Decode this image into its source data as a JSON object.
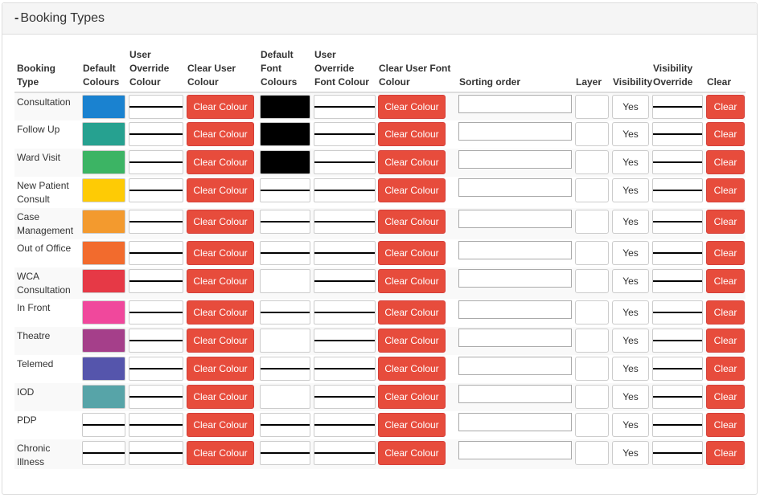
{
  "panel": {
    "toggle": "-",
    "title": "Booking Types"
  },
  "columns": {
    "booking_type": "Booking Type",
    "default_colours": "Default Colours",
    "user_override_colour": "User Override Colour",
    "clear_user_colour": "Clear User Colour",
    "default_font_colours": "Default Font Colours",
    "user_override_font_colour": "User Override Font Colour",
    "clear_user_font_colour": "Clear User Font Colour",
    "sorting_order": "Sorting order",
    "layer": "Layer",
    "visibility": "Visibility",
    "visibility_override": "Visibility Override",
    "clear": "Clear"
  },
  "labels": {
    "clear_colour": "Clear Colour",
    "clear": "Clear",
    "visibility_value": "Yes"
  },
  "rows": [
    {
      "name": "Consultation",
      "colour": "#1a82d0",
      "font_colour": "#000000"
    },
    {
      "name": "Follow Up",
      "colour": "#26a190",
      "font_colour": "#000000"
    },
    {
      "name": "Ward Visit",
      "colour": "#3cb464",
      "font_colour": "#000000"
    },
    {
      "name": "New Patient Consult",
      "colour": "#fecb05",
      "font_colour": "none"
    },
    {
      "name": "Case Management",
      "colour": "#f39a2e",
      "font_colour": "none"
    },
    {
      "name": "Out of Office",
      "colour": "#f26b2d",
      "font_colour": "none"
    },
    {
      "name": "WCA Consultation",
      "colour": "#e63946",
      "font_colour": "empty"
    },
    {
      "name": "In Front",
      "colour": "#f0489c",
      "font_colour": "none"
    },
    {
      "name": "Theatre",
      "colour": "#a53f8a",
      "font_colour": "empty"
    },
    {
      "name": "Telemed",
      "colour": "#5555ac",
      "font_colour": "none"
    },
    {
      "name": "IOD",
      "colour": "#57a4a8",
      "font_colour": "empty"
    },
    {
      "name": "PDP",
      "colour": "none",
      "font_colour": "none"
    },
    {
      "name": "Chronic Illness",
      "colour": "none",
      "font_colour": "none"
    }
  ]
}
